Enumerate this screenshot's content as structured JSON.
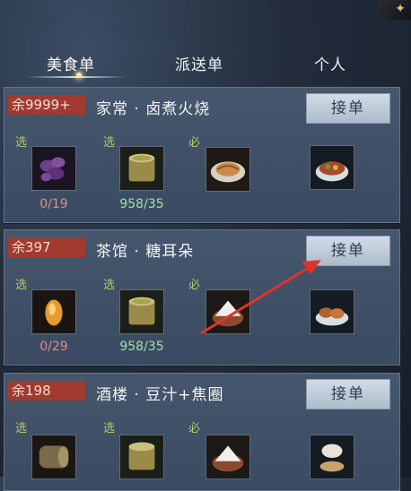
{
  "tabs": [
    {
      "label": "美食单",
      "active": true
    },
    {
      "label": "派送单",
      "active": false
    },
    {
      "label": "个人",
      "active": false
    }
  ],
  "orders": [
    {
      "stock": "余9999+",
      "recipe": "家常 · 卤煮火烧",
      "accept_label": "接单",
      "tags": [
        "选",
        "选",
        "必"
      ],
      "counts": [
        "0/19",
        "958/35"
      ],
      "items": [
        "purple-herb",
        "broth-pot",
        "fried-dough",
        "stew-bowl"
      ]
    },
    {
      "stock": "余397",
      "recipe": "茶馆 · 糖耳朵",
      "accept_label": "接单",
      "tags": [
        "选",
        "选",
        "必"
      ],
      "counts": [
        "0/29",
        "958/35"
      ],
      "items": [
        "amber-crystal",
        "broth-pot",
        "sugar-bowl",
        "fried-twists"
      ]
    },
    {
      "stock": "余198",
      "recipe": "酒楼 · 豆汁+焦圈",
      "accept_label": "接单",
      "tags": [
        "选",
        "选",
        "必"
      ],
      "counts": [],
      "items": [
        "wood-log",
        "broth-pot",
        "sugar-bowl",
        "soy-milk"
      ]
    }
  ],
  "annotation": {
    "color": "#e0332c",
    "icon": "red-arrow"
  }
}
